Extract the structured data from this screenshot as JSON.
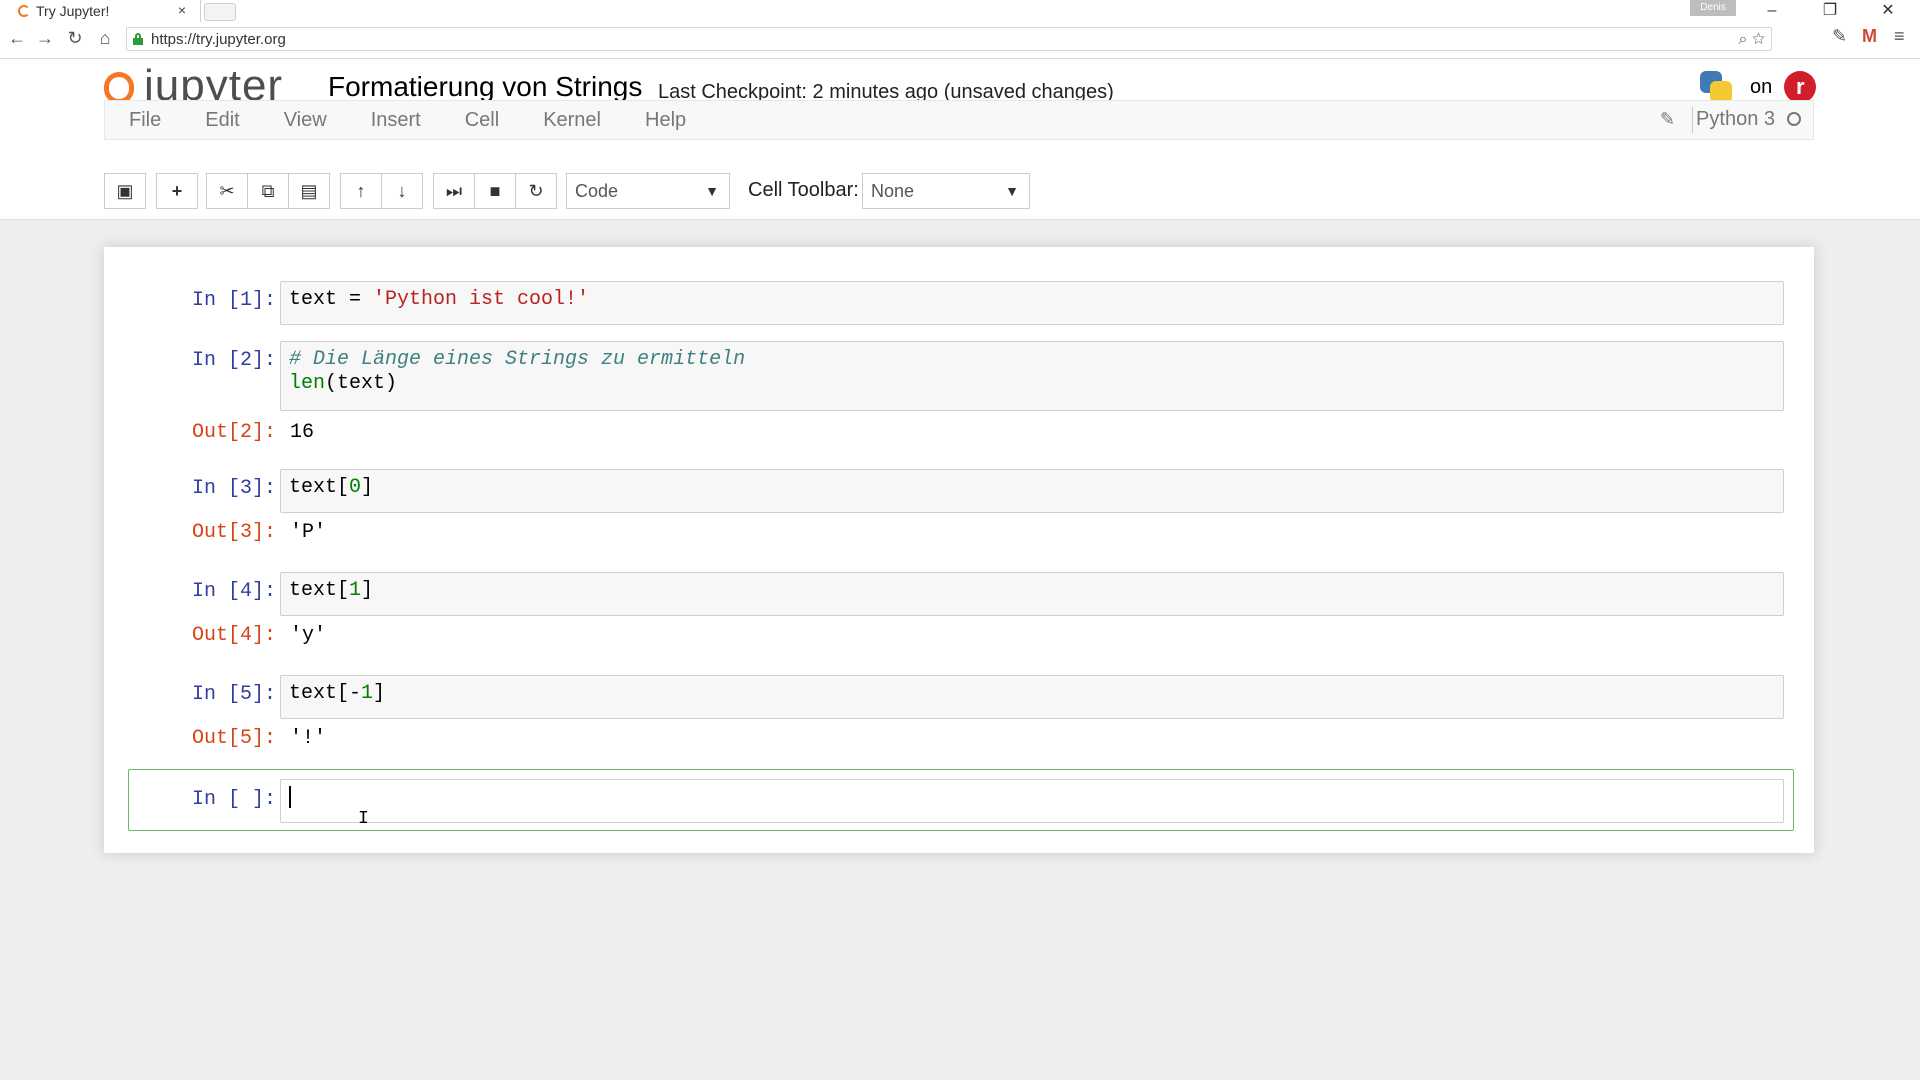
{
  "browser": {
    "tab_title": "Try Jupyter!",
    "tab_close": "×",
    "profile_name": "Denis",
    "url": "https://try.jupyter.org",
    "window_controls": {
      "minimize": "–",
      "restore": "❐",
      "close": "✕"
    },
    "nav": {
      "back": "←",
      "forward": "→",
      "reload": "↻",
      "home": "⌂"
    }
  },
  "jupyter": {
    "logo_text": "jupyter",
    "notebook_title": "Formatierung von Strings",
    "checkpoint": "Last Checkpoint: 2 minutes ago (unsaved changes)",
    "on_text": "on",
    "menu": [
      "File",
      "Edit",
      "View",
      "Insert",
      "Cell",
      "Kernel",
      "Help"
    ],
    "kernel_name": "Python 3",
    "cell_type": "Code",
    "cell_toolbar_label": "Cell Toolbar:",
    "cell_toolbar_value": "None",
    "toolbar_icons": [
      "save-icon",
      "plus-icon",
      "scissors-icon",
      "copy-icon",
      "paste-icon",
      "arrow-up-icon",
      "arrow-down-icon",
      "run-icon",
      "stop-icon",
      "restart-icon"
    ]
  },
  "cells": [
    {
      "prompt": "In [1]:"
    },
    {
      "prompt": "In [2]:",
      "comment": "# Die Länge eines Strings zu ermitteln",
      "out_prompt": "Out[2]:",
      "output": "16"
    },
    {
      "prompt": "In [3]:",
      "out_prompt": "Out[3]:",
      "output": "'P'"
    },
    {
      "prompt": "In [4]:",
      "out_prompt": "Out[4]:",
      "output": "'y'"
    },
    {
      "prompt": "In [5]:",
      "out_prompt": "Out[5]:",
      "output": "'!'"
    },
    {
      "prompt": "In [ ]:"
    }
  ],
  "colors": {
    "jupyter_orange": "#f37726",
    "in_prompt": "#303f9f",
    "out_prompt": "#d84315",
    "selected_border": "#66bb6a"
  }
}
